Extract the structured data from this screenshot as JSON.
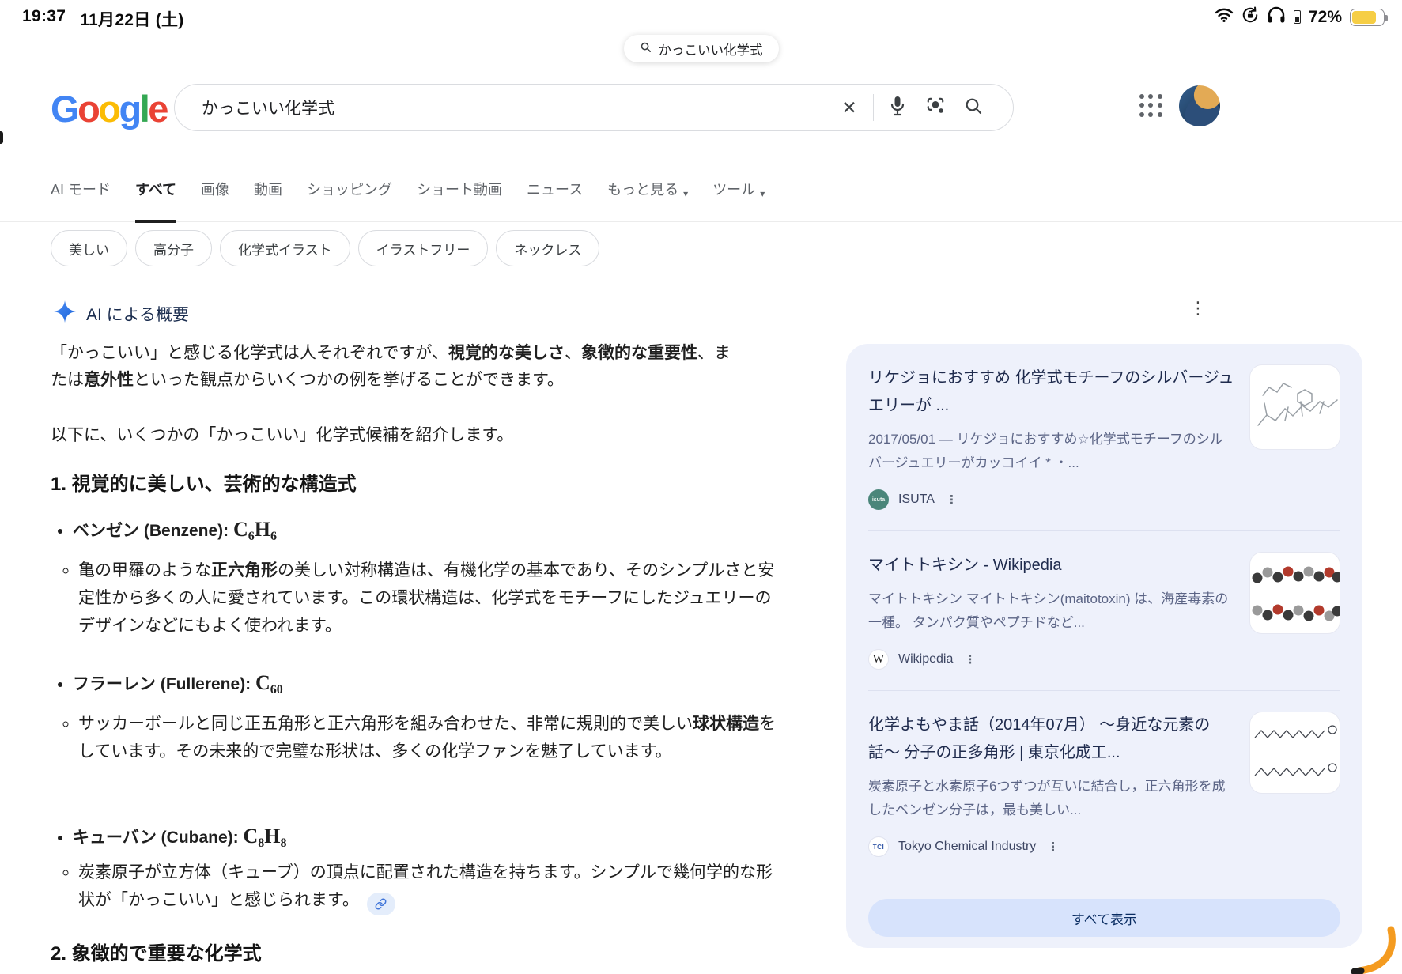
{
  "glyphs": {
    "caret": "▾",
    "kebab": "⋮",
    "close": "✕"
  },
  "colors": {
    "google_blue": "#4285F4",
    "google_red": "#EA4335",
    "google_yellow": "#FBBC05",
    "google_green": "#34A853",
    "battery_low_power": "#f6ce45",
    "panel_bg": "#eef1fb",
    "show_all_bg": "#d7e3fc",
    "sparkle_blue": "#4683f5"
  },
  "status_bar": {
    "time": "19:37",
    "date": "11月22日 (土)",
    "battery": "72%"
  },
  "top_pill": {
    "query": "かっこいい化学式"
  },
  "logo": [
    {
      "ch": "G"
    },
    {
      "ch": "o"
    },
    {
      "ch": "o"
    },
    {
      "ch": "g"
    },
    {
      "ch": "l"
    },
    {
      "ch": "e"
    }
  ],
  "search": {
    "value": "かっこいい化学式"
  },
  "tabs": [
    {
      "label": "AI モード"
    },
    {
      "label": "すべて",
      "selected": true
    },
    {
      "label": "画像"
    },
    {
      "label": "動画"
    },
    {
      "label": "ショッピング"
    },
    {
      "label": "ショート動画"
    },
    {
      "label": "ニュース"
    },
    {
      "label": "もっと見る",
      "dropdown": true
    },
    {
      "label": "ツール",
      "dropdown": true
    }
  ],
  "chips": [
    "美しい",
    "高分子",
    "化学式イラスト",
    "イラストフリー",
    "ネックレス"
  ],
  "ai": {
    "label": "AI による概要",
    "p1": [
      {
        "t": "「かっこいい」と感じる化学式は人それぞれですが、"
      },
      {
        "t": "視覚的な美しさ",
        "b": true
      },
      {
        "t": "、"
      },
      {
        "t": "象徴的な重要性",
        "b": true
      },
      {
        "t": "、または"
      },
      {
        "t": "意外性",
        "b": true
      },
      {
        "t": "といった観点からいくつかの例を挙げることができます。"
      }
    ],
    "p2": "以下に、いくつかの「かっこいい」化学式候補を紹介します。",
    "h1": "1. 視覚的に美しい、芸術的な構造式",
    "bullets": [
      {
        "title": [
          {
            "t": "ベンゼン",
            "b": true
          },
          {
            "t": " (Benzene): ",
            "b": true
          },
          {
            "t": "C",
            "f": true
          },
          {
            "t": "6",
            "f": true,
            "sub": true
          },
          {
            "t": "H",
            "f": true
          },
          {
            "t": "6",
            "f": true,
            "sub": true
          }
        ],
        "desc": [
          {
            "t": "亀の甲羅のような"
          },
          {
            "t": "正六角形",
            "b": true
          },
          {
            "t": "の美しい対称構造は、有機化学の基本であり、そのシンプルさと安定性から多くの人に愛されています。この環状構造は、化学式をモチーフにしたジュエリーのデザインなどにもよく使われます。"
          }
        ]
      },
      {
        "title": [
          {
            "t": "フラーレン",
            "b": true
          },
          {
            "t": " (Fullerene): ",
            "b": true
          },
          {
            "t": "C",
            "f": true
          },
          {
            "t": "60",
            "f": true,
            "sub": true
          }
        ],
        "desc": [
          {
            "t": "サッカーボールと同じ正五角形と正六角形を組み合わせた、非常に規則的で美しい"
          },
          {
            "t": "球状構造",
            "b": true
          },
          {
            "t": "をしています。その未来的で完璧な形状は、多くの化学ファンを魅了しています。"
          }
        ]
      },
      {
        "title": [
          {
            "t": "キューバン",
            "b": true
          },
          {
            "t": " (Cubane): ",
            "b": true
          },
          {
            "t": "C",
            "f": true
          },
          {
            "t": "8",
            "f": true,
            "sub": true
          },
          {
            "t": "H",
            "f": true
          },
          {
            "t": "8",
            "f": true,
            "sub": true
          }
        ],
        "desc": [
          {
            "t": "炭素原子が立方体（キューブ）の頂点に配置された構造を持ちます。シンプルで幾何学的な形状が「かっこいい」と感じられます。"
          }
        ]
      }
    ],
    "h2": "2. 象徴的で重要な化学式"
  },
  "panel": {
    "cards": [
      {
        "title": "リケジョにおすすめ 化学式モチーフのシルバージュエリーが ...",
        "snippet": "2017/05/01 — リケジョにおすすめ☆化学式モチーフのシルバージュエリーがカッコイイ * ・...",
        "source": "ISUTA",
        "favicon_text": "isuta"
      },
      {
        "title": "マイトトキシン - Wikipedia",
        "snippet": "マイトトキシン マイトトキシン(maitotoxin) は、海産毒素の一種。 タンパク質やペプチドなど...",
        "source": "Wikipedia",
        "favicon_text": "W"
      },
      {
        "title": "化学よもやま話（2014年07月） 〜身近な元素の話〜 分子の正多角形 | 東京化成工...",
        "snippet": "炭素原子と水素原子6つずつが互いに結合し，正六角形を成したベンゼン分子は，最も美しい...",
        "source": "Tokyo Chemical Industry",
        "favicon_text": "TCI"
      }
    ],
    "show_all": "すべて表示"
  }
}
